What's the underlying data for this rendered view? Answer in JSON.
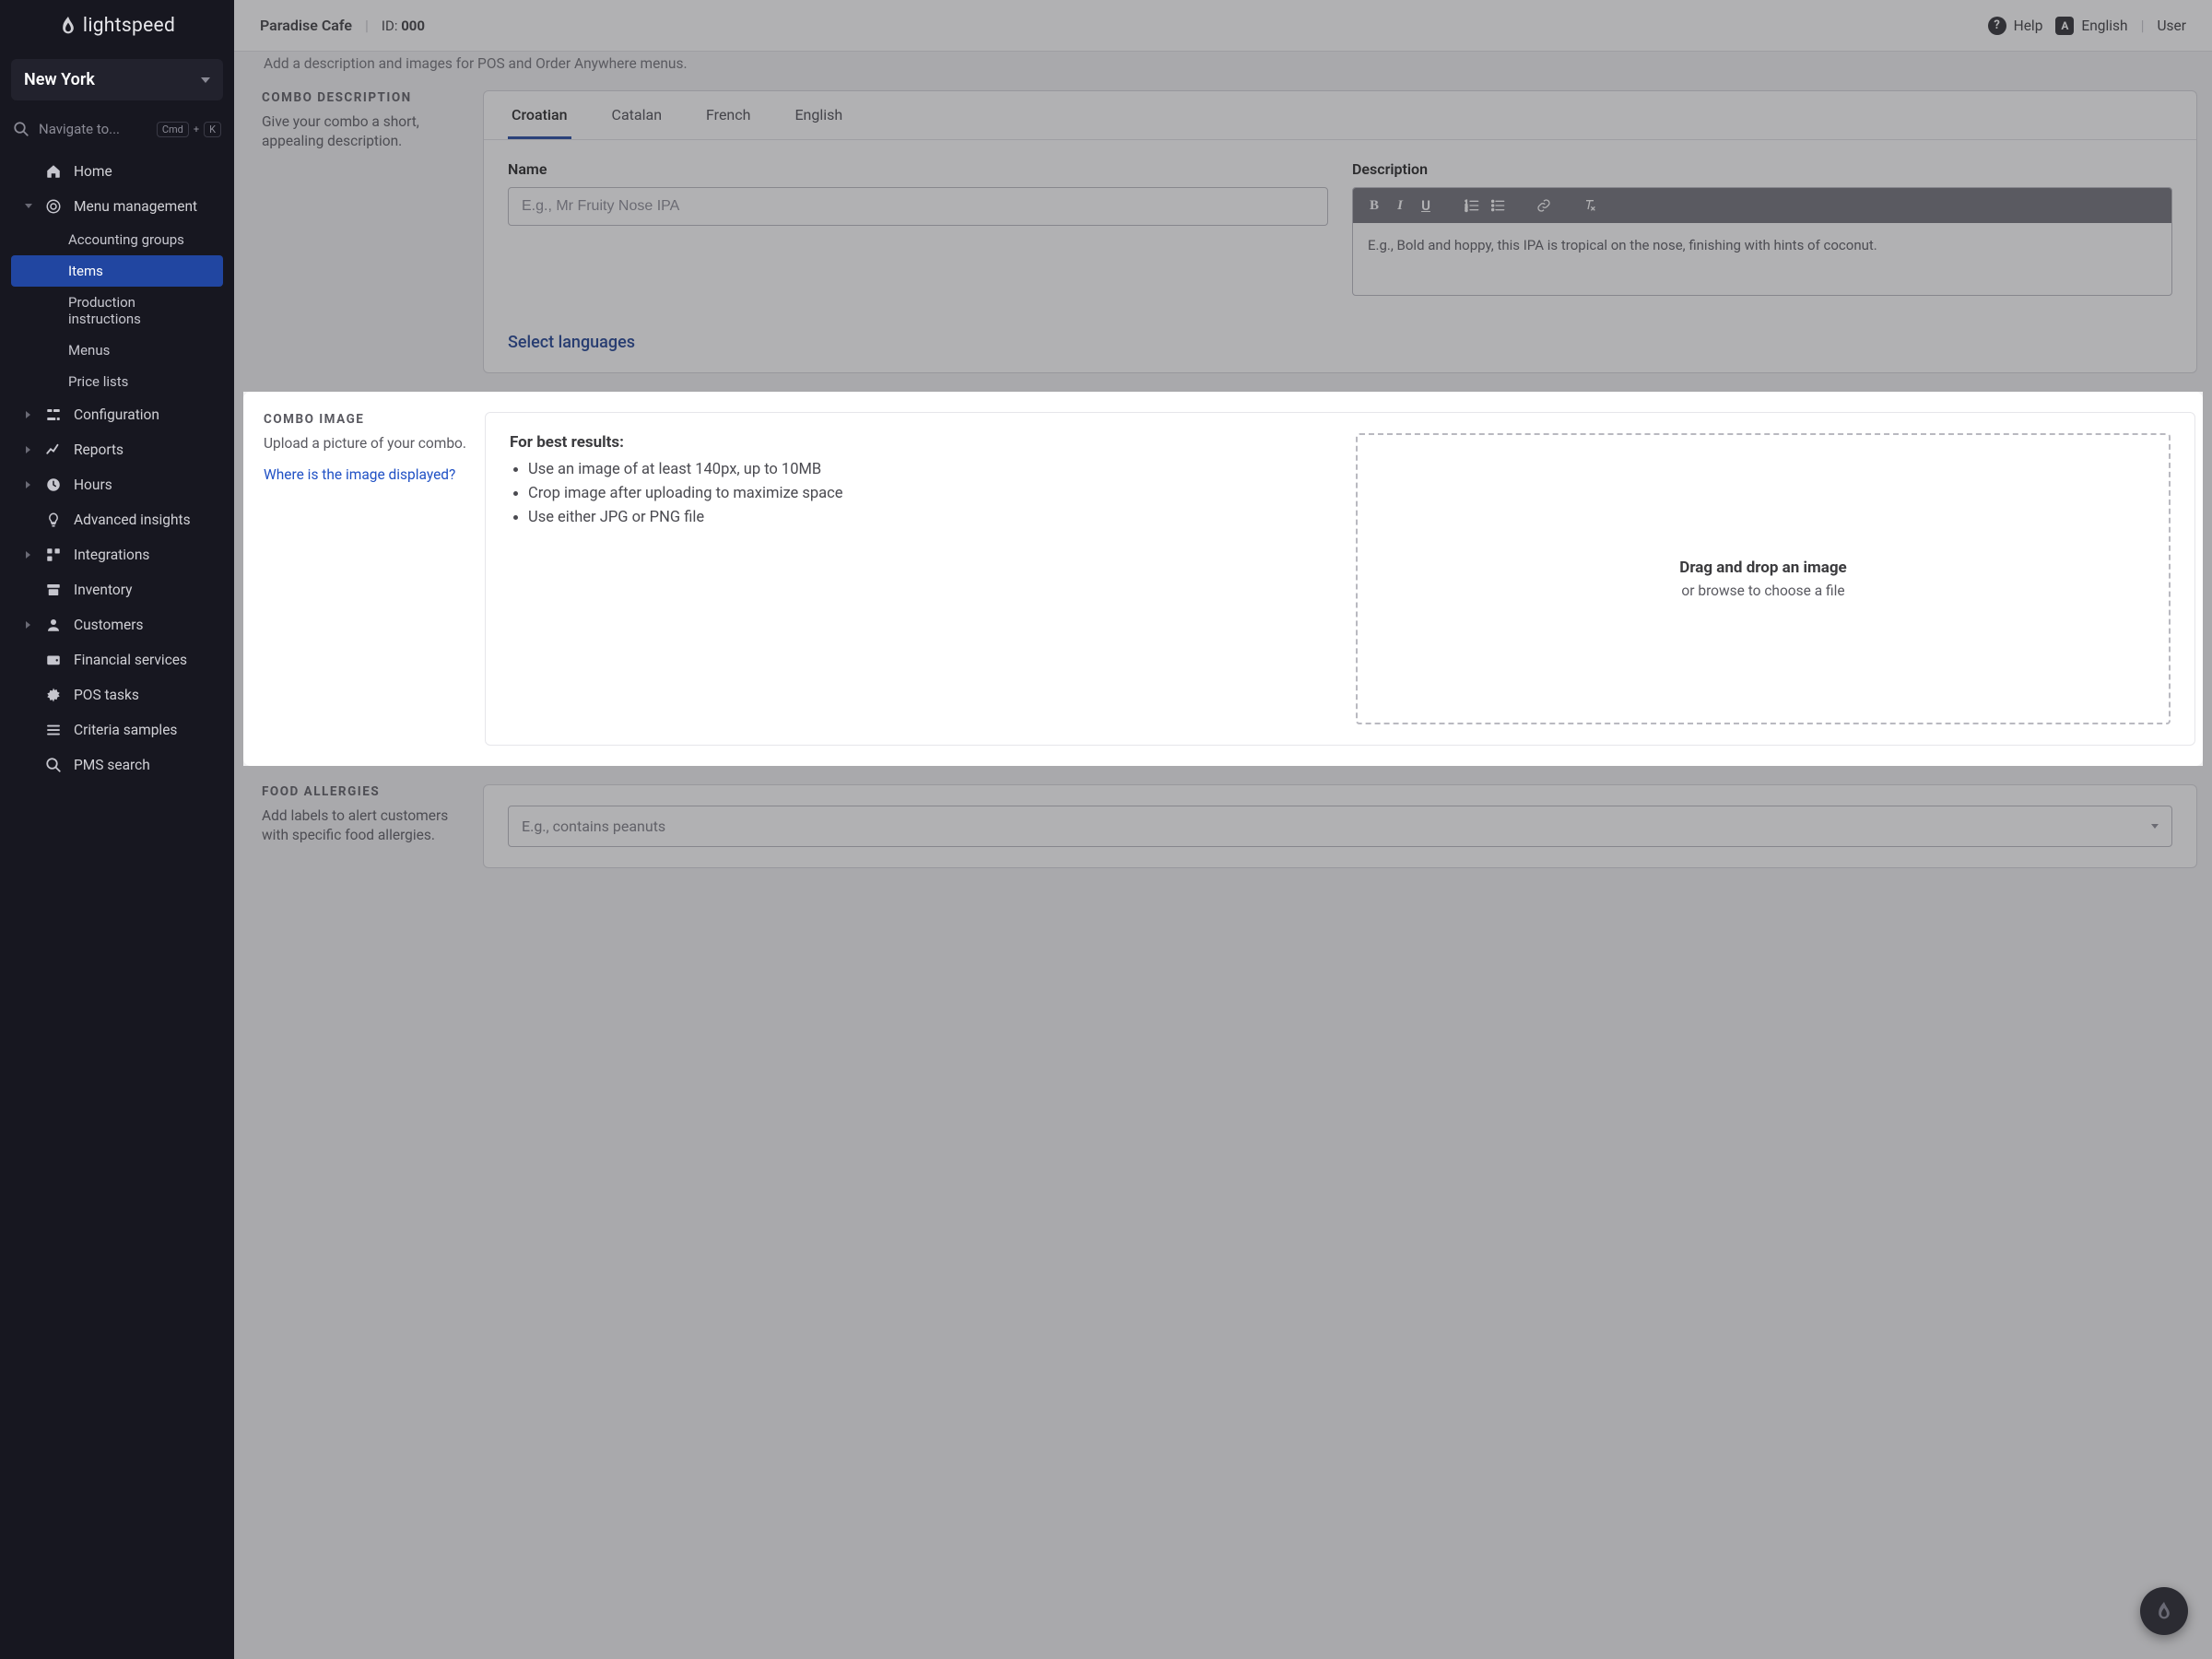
{
  "brand": {
    "name": "lightspeed"
  },
  "location": "New York",
  "search": {
    "placeholder": "Navigate to...",
    "kbd1": "Cmd",
    "kbd2": "K"
  },
  "nav": {
    "home": "Home",
    "menu_management": "Menu management",
    "menu_sub": {
      "accounting_groups": "Accounting groups",
      "items": "Items",
      "production_instructions": "Production instructions",
      "menus": "Menus",
      "price_lists": "Price lists"
    },
    "configuration": "Configuration",
    "reports": "Reports",
    "hours": "Hours",
    "advanced_insights": "Advanced insights",
    "integrations": "Integrations",
    "inventory": "Inventory",
    "customers": "Customers",
    "financial_services": "Financial services",
    "pos_tasks": "POS tasks",
    "criteria_samples": "Criteria samples",
    "pms_search": "PMS search"
  },
  "topbar": {
    "business": "Paradise Cafe",
    "id_label": "ID:",
    "id_value": "000",
    "help": "Help",
    "language": "English",
    "user": "User"
  },
  "page": {
    "intro_truncated": "Add a description and images for POS and Order Anywhere menus.",
    "combo_description": {
      "title": "COMBO DESCRIPTION",
      "subtitle": "Give your combo a short, appealing description.",
      "tabs": [
        "Croatian",
        "Catalan",
        "French",
        "English"
      ],
      "active_tab": 0,
      "name_label": "Name",
      "name_placeholder": "E.g., Mr Fruity Nose IPA",
      "desc_label": "Description",
      "desc_placeholder": "E.g., Bold and hoppy, this IPA is tropical on the nose, finishing with hints of coconut.",
      "select_languages": "Select languages"
    },
    "combo_image": {
      "title": "COMBO IMAGE",
      "subtitle": "Upload a picture of your combo.",
      "where_link": "Where is the image displayed?",
      "best_results": "For best results:",
      "tips": [
        "Use an image of at least 140px, up to 10MB",
        "Crop image after uploading to maximize space",
        "Use either JPG or PNG file"
      ],
      "drop_title": "Drag and drop an image",
      "drop_sub": "or browse to choose a file"
    },
    "food_allergies": {
      "title": "FOOD ALLERGIES",
      "subtitle": "Add labels to alert customers with specific food allergies.",
      "placeholder": "E.g., contains peanuts"
    }
  }
}
